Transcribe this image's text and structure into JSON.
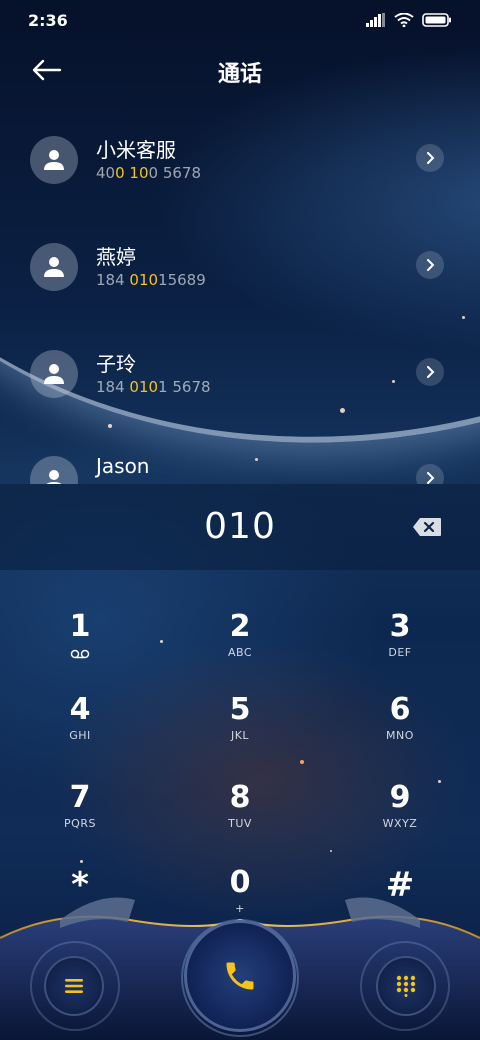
{
  "status": {
    "time": "2:36"
  },
  "header": {
    "title": "通话"
  },
  "contacts": [
    {
      "name": "小米客服",
      "number_parts": [
        "40",
        "0",
        " ",
        "10",
        "0 5678"
      ],
      "highlight": [
        false,
        true,
        false,
        true,
        false
      ]
    },
    {
      "name": "燕婷",
      "number_parts": [
        "184 ",
        "010",
        "15689"
      ],
      "highlight": [
        false,
        true,
        false
      ]
    },
    {
      "name": "子玲",
      "number_parts": [
        "184 ",
        "010",
        "1 5678"
      ],
      "highlight": [
        false,
        true,
        false
      ]
    },
    {
      "name": "Jason",
      "number_parts": [],
      "highlight": []
    }
  ],
  "dialer": {
    "number": "010"
  },
  "keypad": [
    {
      "digit": "1",
      "letters": "",
      "sub_icon": "voicemail-icon"
    },
    {
      "digit": "2",
      "letters": "ABC"
    },
    {
      "digit": "3",
      "letters": "DEF"
    },
    {
      "digit": "4",
      "letters": "GHI"
    },
    {
      "digit": "5",
      "letters": "JKL"
    },
    {
      "digit": "6",
      "letters": "MNO"
    },
    {
      "digit": "7",
      "letters": "PQRS"
    },
    {
      "digit": "8",
      "letters": "TUV"
    },
    {
      "digit": "9",
      "letters": "WXYZ"
    },
    {
      "digit": "*",
      "letters": ""
    },
    {
      "digit": "0",
      "letters": "+"
    },
    {
      "digit": "#",
      "letters": ""
    }
  ],
  "colors": {
    "accent": "#f5c31a",
    "highlight": "#f5c31a"
  },
  "icons": {
    "menu": "menu-icon",
    "call": "phone-icon",
    "keypad_toggle": "dialpad-icon",
    "backspace": "backspace-icon"
  }
}
